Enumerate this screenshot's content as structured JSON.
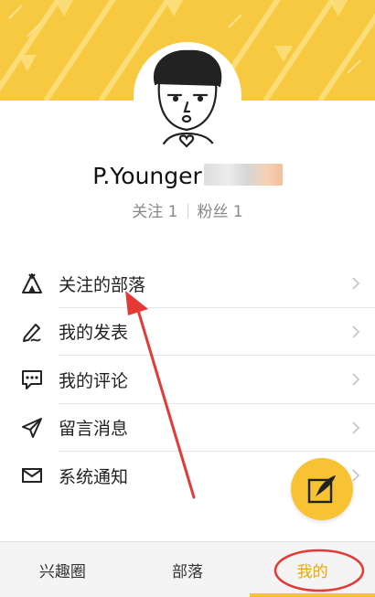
{
  "profile": {
    "username": "P.Younger",
    "following_label": "关注",
    "following_count": "1",
    "fans_label": "粉丝",
    "fans_count": "1"
  },
  "menu": {
    "items": [
      {
        "label": "关注的部落",
        "icon": "tent-icon"
      },
      {
        "label": "我的发表",
        "icon": "pen-icon"
      },
      {
        "label": "我的评论",
        "icon": "comment-icon"
      },
      {
        "label": "留言消息",
        "icon": "send-icon"
      },
      {
        "label": "系统通知",
        "icon": "mail-icon"
      }
    ]
  },
  "fab": {
    "icon": "compose-icon"
  },
  "tabs": [
    {
      "label": "兴趣圈",
      "active": false
    },
    {
      "label": "部落",
      "active": false
    },
    {
      "label": "我的",
      "active": true
    }
  ],
  "colors": {
    "accent": "#f7c233",
    "banner": "#f7c940",
    "annotation": "#e53935"
  }
}
